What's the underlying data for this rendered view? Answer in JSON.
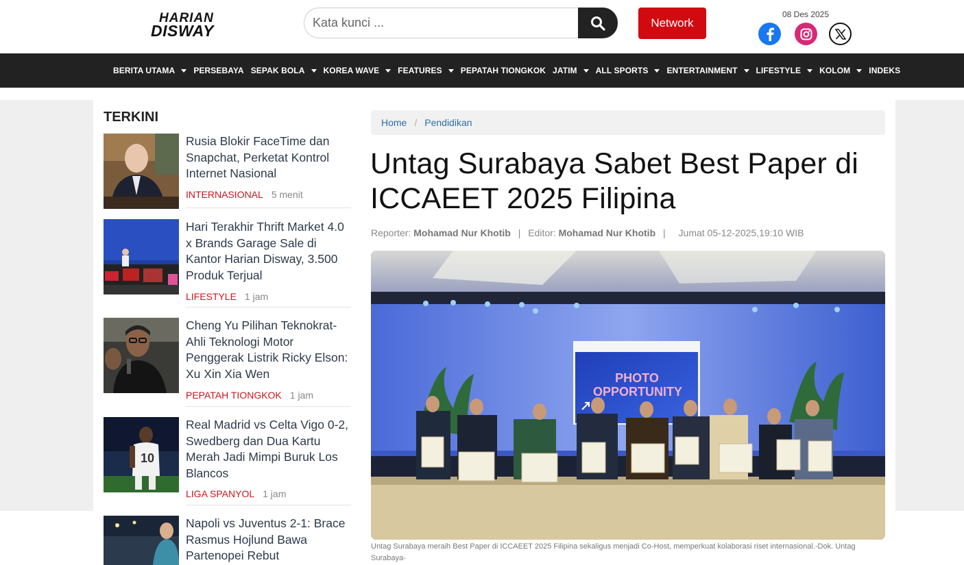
{
  "brand": {
    "line1": "HARIAN",
    "line2": "DISWAY"
  },
  "header": {
    "search_placeholder": "Kata kunci ...",
    "network_label": "Network",
    "date": "08 Des 2025"
  },
  "nav": [
    {
      "label": "BERITA UTAMA",
      "dropdown": true
    },
    {
      "label": "PERSEBAYA",
      "dropdown": false
    },
    {
      "label": "SEPAK BOLA",
      "dropdown": true
    },
    {
      "label": "KOREA WAVE",
      "dropdown": true
    },
    {
      "label": "FEATURES",
      "dropdown": true
    },
    {
      "label": "PEPATAH TIONGKOK",
      "dropdown": false
    },
    {
      "label": "JATIM",
      "dropdown": true
    },
    {
      "label": "ALL SPORTS",
      "dropdown": true
    },
    {
      "label": "ENTERTAINMENT",
      "dropdown": true
    },
    {
      "label": "LIFESTYLE",
      "dropdown": true
    },
    {
      "label": "KOLOM",
      "dropdown": true
    },
    {
      "label": "INDEKS",
      "dropdown": false
    }
  ],
  "sidebar": {
    "heading": "TERKINI",
    "items": [
      {
        "title": "Rusia Blokir FaceTime dan Snapchat, Perketat Kontrol Internet Nasional",
        "category": "INTERNASIONAL",
        "time": "5 menit"
      },
      {
        "title": "Hari Terakhir Thrift Market 4.0 x Brands Garage Sale di Kantor Harian Disway, 3.500 Produk Terjual",
        "category": "LIFESTYLE",
        "time": "1 jam"
      },
      {
        "title": "Cheng Yu Pilihan Teknokrat-Ahli Teknologi Motor Penggerak Listrik Ricky Elson: Xu Xin Xia Wen",
        "category": "PEPATAH TIONGKOK",
        "time": "1 jam"
      },
      {
        "title": "Real Madrid vs Celta Vigo 0-2, Swedberg dan Dua Kartu Merah Jadi Mimpi Buruk Los Blancos",
        "category": "LIGA SPANYOL",
        "time": "1 jam"
      },
      {
        "title": "Napoli vs Juventus 2-1: Brace Rasmus Hojlund Bawa Partenopei Rebut",
        "category": "",
        "time": ""
      }
    ]
  },
  "article": {
    "breadcrumb": [
      "Home",
      "Pendidikan"
    ],
    "title": "Untag Surabaya Sabet Best Paper di ICCAEET 2025 Filipina",
    "reporter_label": "Reporter:",
    "reporter": "Mohamad Nur Khotib",
    "editor_label": "Editor:",
    "editor": "Mohamad Nur Khotib",
    "datetime": "Jumat 05-12-2025,19:10 WIB",
    "screen_text_1": "PHOTO",
    "screen_text_2": "OPPORTUNITY",
    "caption": "Untag Surabaya meraih Best Paper di ICCAEET 2025 Filipina sekaligus menjadi Co-Host, memperkuat kolaborasi riset internasional.-Dok. Untag Surabaya-"
  },
  "colors": {
    "accent_red": "#d10a10",
    "nav_bg": "#222222",
    "category_red": "#c8161d",
    "link_blue": "#2e6da4"
  }
}
